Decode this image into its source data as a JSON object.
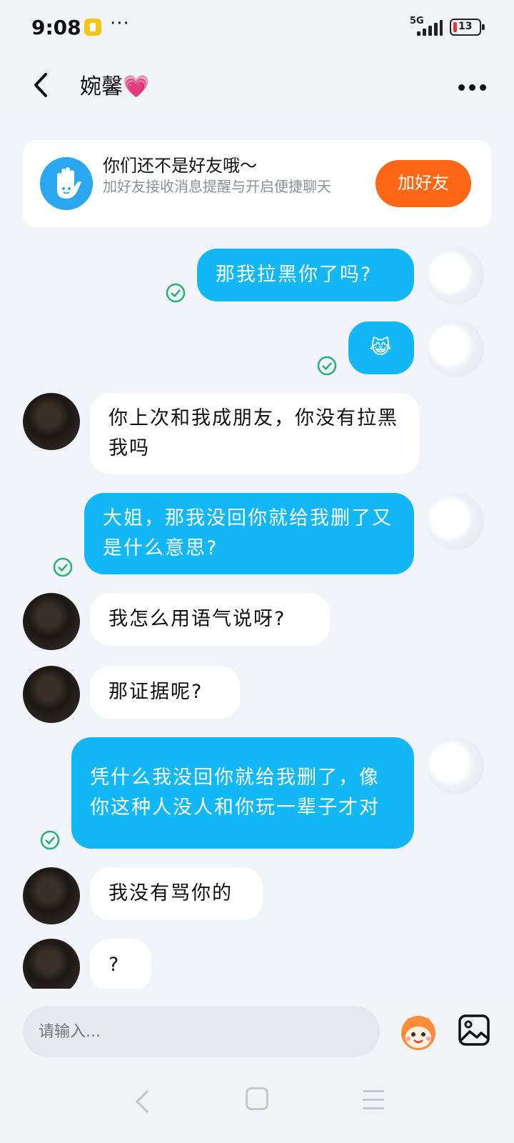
{
  "status_bar": {
    "time": "9:08",
    "more": "···",
    "network": "5G",
    "battery": "13",
    "battery_color": "#e53935"
  },
  "header": {
    "title": "婉馨💗",
    "back_icon": "chevron-left-icon",
    "more_icon": "more-horizontal-icon"
  },
  "friend_card": {
    "title": "你们还不是好友哦～",
    "subtitle": "加好友接收消息提醒与开启便捷聊天",
    "button": "加好友",
    "button_color": "#ff6615",
    "icon": "waving-hand-icon"
  },
  "messages": [
    {
      "side": "out",
      "text": "那我拉黑你了吗?",
      "read": true
    },
    {
      "side": "out",
      "text": "😹",
      "read": true
    },
    {
      "side": "in",
      "text": "你上次和我成朋友，你没有拉黑我吗"
    },
    {
      "side": "out",
      "text": "大姐，那我没回你就给我删了又是什么意思?",
      "read": true
    },
    {
      "side": "in",
      "text": "我怎么用语气说呀?"
    },
    {
      "side": "in",
      "text": "那证据呢?"
    },
    {
      "side": "out",
      "text": "凭什么我没回你就给我删了，像你这种人没人和你玩一辈子才对",
      "read": true
    },
    {
      "side": "in",
      "text": "我没有骂你的"
    },
    {
      "side": "in",
      "text": "?"
    }
  ],
  "input": {
    "placeholder": "请输入...",
    "emoji_icon": "emoji-mascot-icon",
    "image_icon": "image-icon"
  },
  "colors": {
    "outgoing_bubble": "#12b7f5",
    "read_check": "#22b573",
    "background": "#f1f3f8"
  }
}
